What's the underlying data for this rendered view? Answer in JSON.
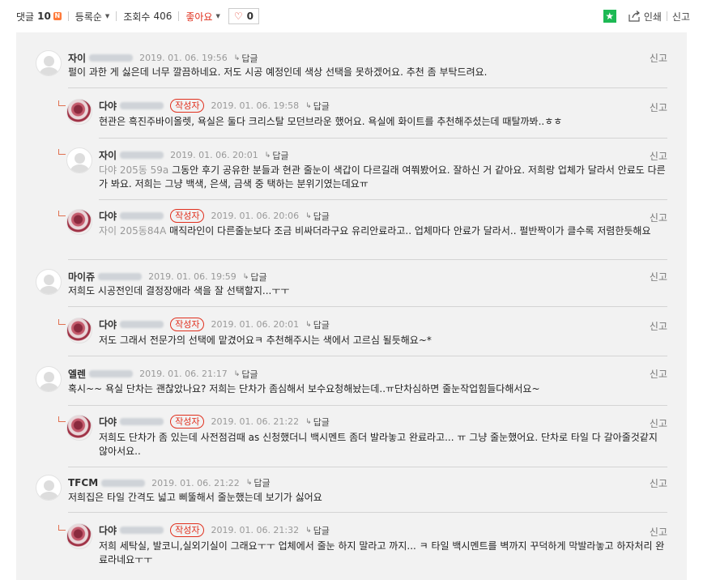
{
  "toolbar": {
    "comments_label": "댓글",
    "comments_count": "10",
    "new_badge": "N",
    "sort_label": "등록순",
    "views_label": "조회수",
    "views_count": "406",
    "like_label": "좋아요",
    "like_count": "0",
    "print_label": "인쇄",
    "report_label": "신고"
  },
  "comments": [
    {
      "author": "자이",
      "date": "2019. 01. 06. 19:56",
      "reply": "답글",
      "report": "신고",
      "mention": "",
      "text": "펄이 과한 게 싫은데 너무 깔끔하네요. 저도 시공 예정인데 색상 선택을 못하겠어요. 추천 좀 부탁드려요."
    },
    {
      "author": "다야",
      "badge": "작성자",
      "date": "2019. 01. 06. 19:58",
      "reply": "답글",
      "report": "신고",
      "mention": "",
      "text": "현관은 흑진주바이올렛, 욕실은 둘다 크리스탈 모던브라운 했어요. 욕실에 화이트를 추천해주셨는데 때탈까봐..ㅎㅎ"
    },
    {
      "author": "자이",
      "date": "2019. 01. 06. 20:01",
      "reply": "답글",
      "report": "신고",
      "mention": "다야 205동 59a",
      "text": " 그동안 후기 공유한 분들과 현관 줄눈이 색갑이 다르길래 여쭤봤어요. 잘하신 거 같아요. 저희랑 업체가 달라서 안료도 다른가 봐요. 저희는 그냥 백색, 은색, 금색 중 택하는 분위기였는데요ㅠ"
    },
    {
      "author": "다야",
      "badge": "작성자",
      "date": "2019. 01. 06. 20:06",
      "reply": "답글",
      "report": "신고",
      "mention": "자이 205동84A",
      "text": " 매직라인이 다른줄눈보다 조금 비싸더라구요 유리안료라고.. 업체마다 안료가 달라서.. 펄반짝이가 클수록 저렴한듯해요"
    },
    {
      "author": "마이쥬",
      "date": "2019. 01. 06. 19:59",
      "reply": "답글",
      "report": "신고",
      "mention": "",
      "text": "저희도 시공전인데 결정장애라 색을 잘 선택할지...ㅜㅜ"
    },
    {
      "author": "다야",
      "badge": "작성자",
      "date": "2019. 01. 06. 20:01",
      "reply": "답글",
      "report": "신고",
      "mention": "",
      "text": "저도 그래서 전문가의 선택에 맡겼어요ㅋ 추천해주시는 색에서 고르심 될듯해요~*"
    },
    {
      "author": "엘렌",
      "date": "2019. 01. 06. 21:17",
      "reply": "답글",
      "report": "신고",
      "mention": "",
      "text": "혹시~~ 욕실 단차는 괜찮았나요? 저희는 단차가 좀심해서 보수요청해놨는데..ㅠ단차심하면 줄눈작업힘들다해서요~"
    },
    {
      "author": "다야",
      "badge": "작성자",
      "date": "2019. 01. 06. 21:22",
      "reply": "답글",
      "report": "신고",
      "mention": "",
      "text": "저희도 단차가 좀 있는데 사전점검때 as 신청했더니 백시멘트 좀더 발라놓고 완료라고... ㅠ 그냥 줄눈했어요. 단차로 타일 다 갈아줄것같지 않아서요.."
    },
    {
      "author": "TFCM",
      "date": "2019. 01. 06. 21:22",
      "reply": "답글",
      "report": "신고",
      "mention": "",
      "text": "저희집은 타일 간격도 넓고 삐뚤해서 줄눈했는데 보기가 싫어요"
    },
    {
      "author": "다야",
      "badge": "작성자",
      "date": "2019. 01. 06. 21:32",
      "reply": "답글",
      "report": "신고",
      "mention": "",
      "text": "저희 세탁실, 발코니,실외기실이 그래요ㅜㅜ 업체에서 줄눈 하지 말라고 까지... ㅋ 타일 백시멘트를 벽까지 꾸덕하게 막발라놓고 하자처리 완료라네요ㅜㅜ"
    }
  ]
}
